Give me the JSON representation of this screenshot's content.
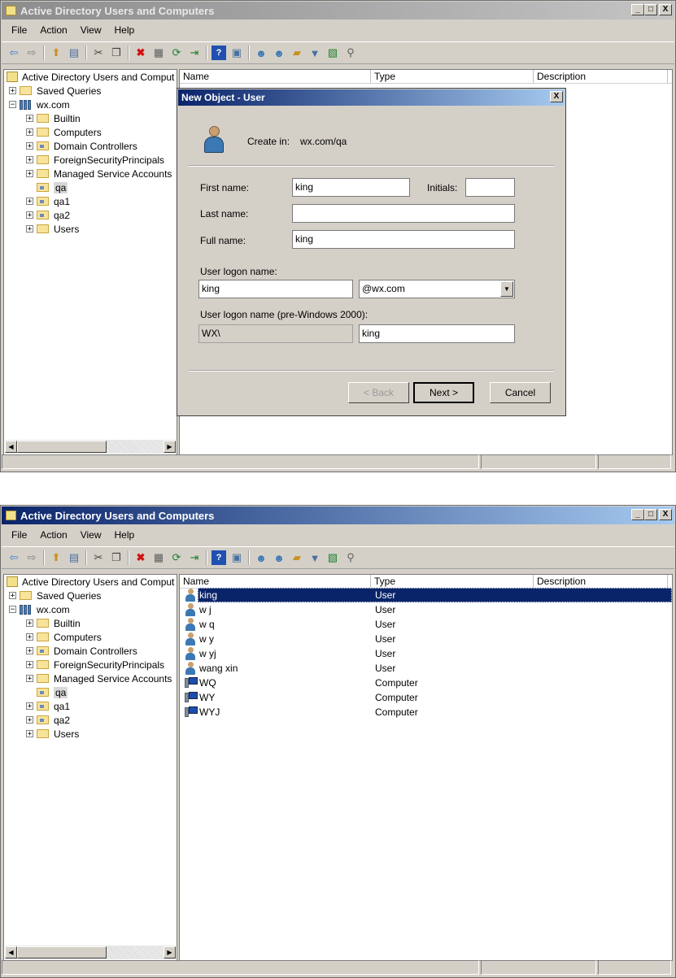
{
  "window": {
    "title": "Active Directory Users and Computers",
    "minimize": "_",
    "maximize": "□",
    "close": "X"
  },
  "menu": [
    "File",
    "Action",
    "View",
    "Help"
  ],
  "toolbar_icons": [
    "back-icon",
    "forward-icon",
    "up-icon",
    "show-hide-tree-icon",
    "cut-icon",
    "copy-icon",
    "delete-icon",
    "properties-icon",
    "refresh-icon",
    "export-icon",
    "help-icon",
    "console-icon",
    "new-user-icon",
    "new-group-icon",
    "new-ou-icon",
    "filter-icon",
    "add-to-group-icon",
    "find-icon"
  ],
  "tree": {
    "root": "Active Directory Users and Comput",
    "saved_queries": "Saved Queries",
    "domain": "wx.com",
    "children": [
      "Builtin",
      "Computers",
      "Domain Controllers",
      "ForeignSecurityPrincipals",
      "Managed Service Accounts",
      "qa",
      "qa1",
      "qa2",
      "Users"
    ],
    "ou_children": [
      "Domain Controllers",
      "qa",
      "qa1",
      "qa2"
    ],
    "selected": "qa"
  },
  "columns": [
    "Name",
    "Type",
    "Description"
  ],
  "dialog": {
    "title": "New Object - User",
    "close": "X",
    "create_in_label": "Create in:",
    "create_in_value": "wx.com/qa",
    "first_name_label": "First name:",
    "first_name_value": "king",
    "initials_label": "Initials:",
    "initials_value": "",
    "last_name_label": "Last name:",
    "last_name_value": "",
    "full_name_label": "Full name:",
    "full_name_value": "king",
    "logon_label": "User logon name:",
    "logon_value": "king",
    "logon_domain": "@wx.com",
    "pre2000_label": "User logon name (pre-Windows 2000):",
    "pre2000_domain": "WX\\",
    "pre2000_value": "king",
    "back_button": "< Back",
    "next_button": "Next >",
    "cancel_button": "Cancel"
  },
  "list": [
    {
      "name": "king",
      "type": "User",
      "description": "",
      "icon": "user"
    },
    {
      "name": "w j",
      "type": "User",
      "description": "",
      "icon": "user"
    },
    {
      "name": "w q",
      "type": "User",
      "description": "",
      "icon": "user"
    },
    {
      "name": "w y",
      "type": "User",
      "description": "",
      "icon": "user"
    },
    {
      "name": "w yj",
      "type": "User",
      "description": "",
      "icon": "user"
    },
    {
      "name": "wang xin",
      "type": "User",
      "description": "",
      "icon": "user"
    },
    {
      "name": "WQ",
      "type": "Computer",
      "description": "",
      "icon": "computer"
    },
    {
      "name": "WY",
      "type": "Computer",
      "description": "",
      "icon": "computer"
    },
    {
      "name": "WYJ",
      "type": "Computer",
      "description": "",
      "icon": "computer"
    }
  ],
  "selected_row": "king"
}
